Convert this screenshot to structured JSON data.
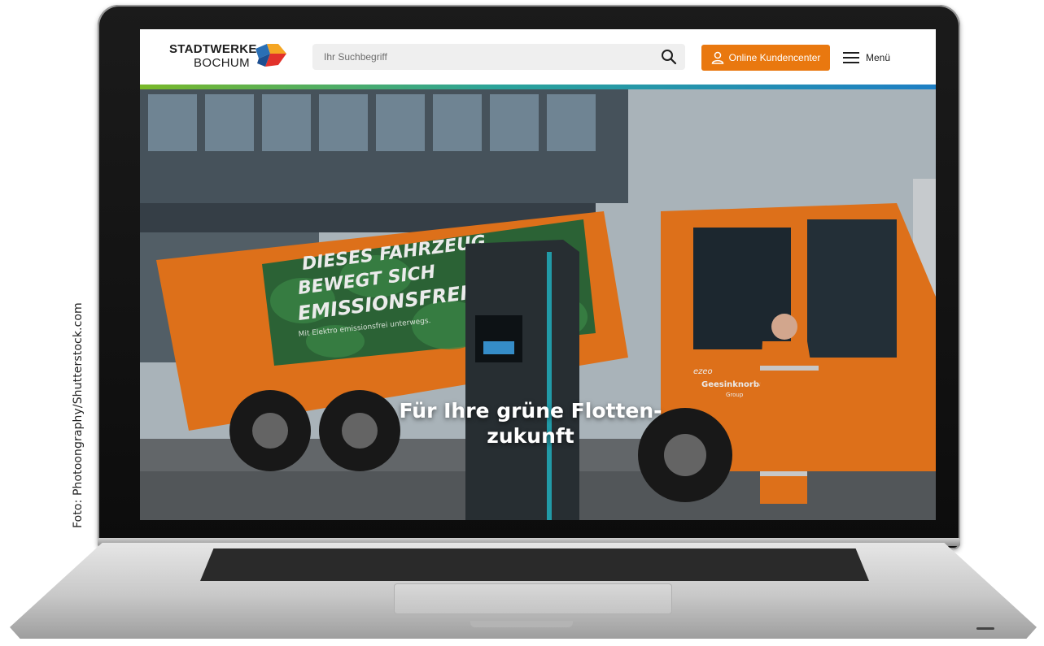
{
  "photo_credit": "Foto: Photoongraphy/Shutterstock.com",
  "header": {
    "logo_line1": "STADTWERKE",
    "logo_line2": "BOCHUM",
    "search_placeholder": "Ihr Suchbegriff",
    "kundencenter_label": "Online Kundencenter",
    "menu_label": "Menü"
  },
  "hero": {
    "title_line1": "Für Ihre grüne Flotten-",
    "title_line2": "zukunft",
    "truck_text_line1": "DIESES FAHRZEUG",
    "truck_text_line2": "BEWEGT SICH",
    "truck_text_line3": "EMISSIONSFREI",
    "truck_subtext": "Mit Elektro emissionsfrei unterwegs.",
    "door_text": "Geesinknorba",
    "door_subtext": "Group",
    "door_small": "ezeo"
  },
  "colors": {
    "accent_orange": "#e9780f",
    "stripe_green": "#79b829",
    "stripe_blue": "#1e7fc4",
    "truck_orange": "#f07a1d"
  },
  "icons": {
    "search": "search-icon",
    "user": "user-icon",
    "menu": "hamburger-icon",
    "logo": "stadtwerke-logo-mark"
  }
}
